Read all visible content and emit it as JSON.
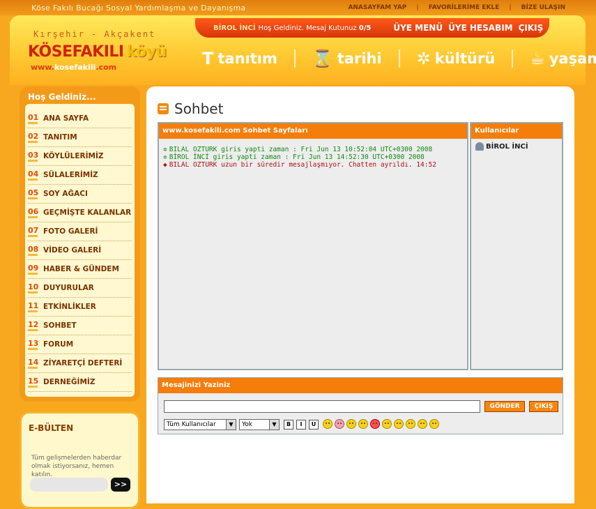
{
  "top": {
    "tagline": "Köse Fakılı Bucağı Sosyal Yardımlaşma ve Dayanışma",
    "links": [
      "ANASAYFAM YAP",
      "FAVORİLERİME EKLE",
      "BİZE ULAŞIN"
    ]
  },
  "logo": {
    "sub": "Kırşehir - Akçakent",
    "main": "KÖSEFAKILI",
    "koyu": "köyü",
    "url_prefix": "www.",
    "url_name": "kosefakili",
    "url_suffix": ".com"
  },
  "userbar": {
    "name": "BİROL İNCİ",
    "greeting": "Hoş Geldiniz. Mesaj Kutunuz",
    "count": "0/5",
    "links": [
      "ÜYE MENÜ",
      "ÜYE HESABIM",
      "ÇIKIŞ"
    ]
  },
  "mainnav": [
    {
      "label": "tanıtım",
      "icon": "T"
    },
    {
      "label": "tarihi",
      "icon": "⌛"
    },
    {
      "label": "kültürü",
      "icon": "✲"
    },
    {
      "label": "yaşamı",
      "icon": "☕"
    }
  ],
  "sidebar": {
    "title": "Hoş Geldiniz...",
    "items": [
      {
        "num": "01",
        "label": "ANA SAYFA"
      },
      {
        "num": "02",
        "label": "TANITIM"
      },
      {
        "num": "03",
        "label": "KÖYLÜLERİMİZ"
      },
      {
        "num": "04",
        "label": "SÜLALERİMİZ"
      },
      {
        "num": "05",
        "label": "SOY AĞACI"
      },
      {
        "num": "06",
        "label": "GEÇMİŞTE KALANLAR"
      },
      {
        "num": "07",
        "label": "FOTO GALERİ"
      },
      {
        "num": "08",
        "label": "VİDEO GALERİ"
      },
      {
        "num": "09",
        "label": "HABER & GÜNDEM"
      },
      {
        "num": "10",
        "label": "DUYURULAR"
      },
      {
        "num": "11",
        "label": "ETKİNLİKLER"
      },
      {
        "num": "12",
        "label": "SOHBET"
      },
      {
        "num": "13",
        "label": "FORUM"
      },
      {
        "num": "14",
        "label": "ZİYARETÇİ DEFTERİ"
      },
      {
        "num": "15",
        "label": "DERNEĞİMİZ"
      }
    ]
  },
  "bulten": {
    "title": "E-BÜLTEN",
    "text": "Tüm gelişmelerden haberdar olmak istiyorsanız, hemen katılın.",
    "button": ">>"
  },
  "page": {
    "title": "Sohbet"
  },
  "chat": {
    "header": "www.kosefakili.com Sohbet Sayfaları",
    "messages": [
      {
        "icon": "✲",
        "text": "BILAL OZTURK giris yapti zaman : Fri Jun 13 10:52:04 UTC+0300 2008",
        "color": "green"
      },
      {
        "icon": "✲",
        "text": "BİROL İNCİ giris yapti zaman : Fri Jun 13 14:52:30 UTC+0300 2008",
        "color": "green"
      },
      {
        "icon": "◆",
        "text": "BILAL OZTURK uzun bir süredir mesajlaşmıyor. Chatten ayrıldı. 14:52",
        "color": "red"
      }
    ]
  },
  "users": {
    "header": "Kullanıcılar",
    "list": [
      "BİROL İNCİ"
    ]
  },
  "compose": {
    "header": "Mesajinizi Yaziniz",
    "input_value": "",
    "send": "GÖNDER",
    "exit": "ÇIKIŞ",
    "recipient": "Tüm Kullanıcılar",
    "color": "Yok",
    "fmt": [
      "B",
      "I",
      "U"
    ]
  }
}
